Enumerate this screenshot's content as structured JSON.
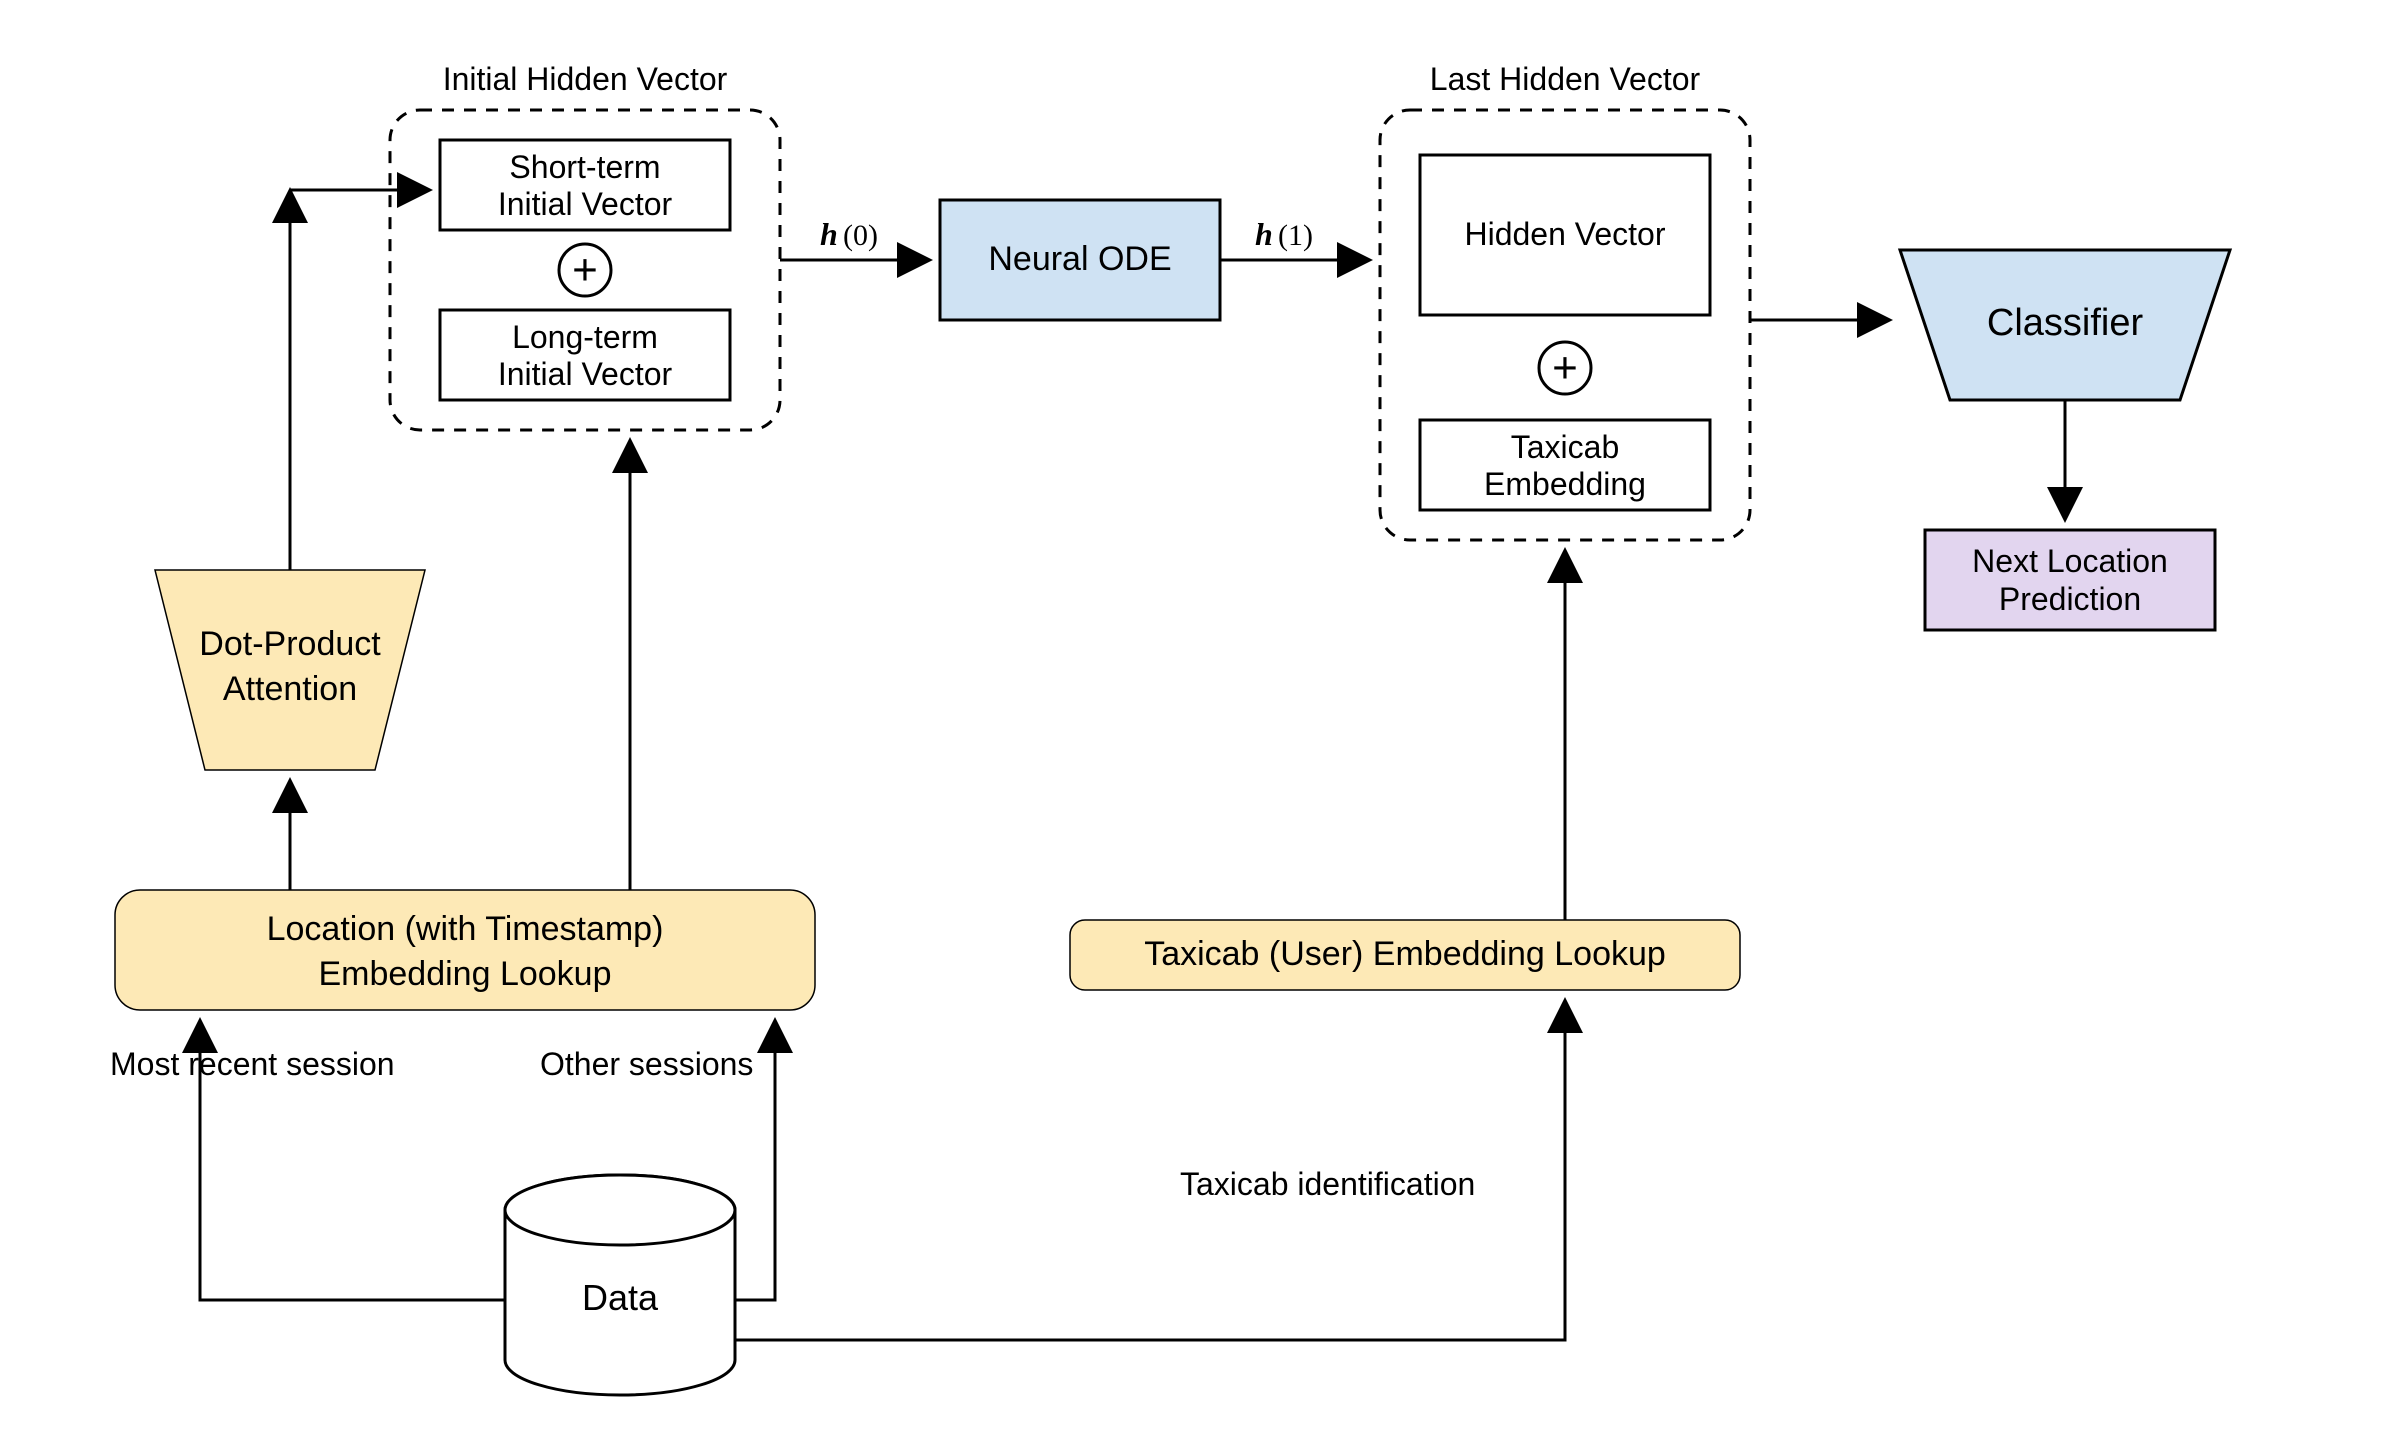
{
  "titles": {
    "initialHidden": "Initial Hidden Vector",
    "lastHidden": "Last Hidden Vector"
  },
  "blocks": {
    "shortTerm1": "Short-term",
    "shortTerm2": "Initial Vector",
    "longTerm1": "Long-term",
    "longTerm2": "Initial Vector",
    "neuralODE": "Neural ODE",
    "hiddenVector": "Hidden Vector",
    "taxicabEmb1": "Taxicab",
    "taxicabEmb2": "Embedding",
    "classifier": "Classifier",
    "nextLoc1": "Next Location",
    "nextLoc2": "Prediction",
    "dotProd1": "Dot-Product",
    "dotProd2": "Attention",
    "locEmb1": "Location (with Timestamp)",
    "locEmb2": "Embedding Lookup",
    "userEmb": "Taxicab (User) Embedding Lookup",
    "data": "Data"
  },
  "edgeLabels": {
    "h0": "h",
    "h0p": "(0)",
    "h1": "h",
    "h1p": "(1)",
    "mostRecent": "Most recent session",
    "other": "Other sessions",
    "taxiId": "Taxicab identification"
  }
}
